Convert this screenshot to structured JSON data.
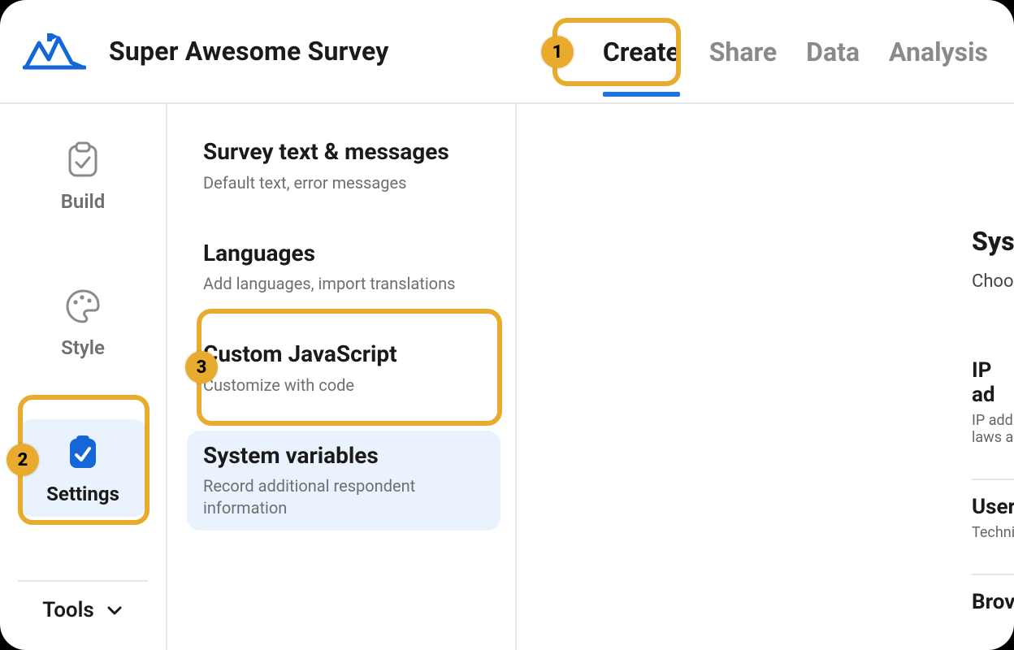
{
  "header": {
    "survey_title": "Super Awesome Survey",
    "tabs": [
      {
        "label": "Create",
        "active": true
      },
      {
        "label": "Share",
        "active": false
      },
      {
        "label": "Data",
        "active": false
      },
      {
        "label": "Analysis",
        "active": false
      }
    ]
  },
  "callouts": {
    "one": "1",
    "two": "2",
    "three": "3"
  },
  "rail": {
    "items": [
      {
        "label": "Build",
        "active": false
      },
      {
        "label": "Style",
        "active": false
      },
      {
        "label": "Settings",
        "active": true
      }
    ],
    "tools_label": "Tools"
  },
  "settings_list": [
    {
      "title": "Survey text & messages",
      "desc": "Default text, error messages",
      "selected": false
    },
    {
      "title": "Languages",
      "desc": "Add languages, import translations",
      "selected": false
    },
    {
      "title": "Custom JavaScript",
      "desc": "Customize with code",
      "selected": false
    },
    {
      "title": "System variables",
      "desc": "Record additional respondent information",
      "selected": true
    }
  ],
  "content": {
    "heading_fragment": "Sys",
    "lead_fragment": "Choo",
    "rows": [
      {
        "title": "IP ad",
        "desc": "IP add\nlaws a"
      },
      {
        "title": "User",
        "desc": "Techni"
      },
      {
        "title": "Brov",
        "desc": ""
      }
    ]
  }
}
